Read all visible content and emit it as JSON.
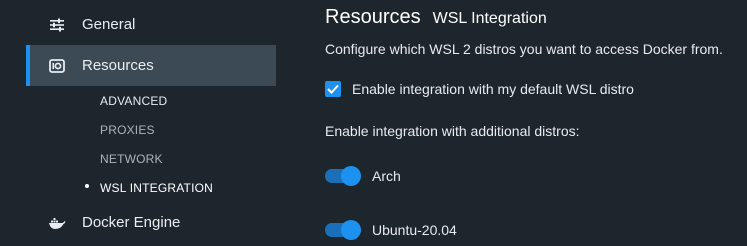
{
  "sidebar": {
    "items": [
      {
        "label": "General",
        "icon": "sliders-icon"
      },
      {
        "label": "Resources",
        "icon": "resources-icon",
        "active": true
      },
      {
        "label": "Docker Engine",
        "icon": "whale-icon"
      }
    ],
    "subitems": [
      {
        "label": "ADVANCED"
      },
      {
        "label": "PROXIES"
      },
      {
        "label": "NETWORK"
      },
      {
        "label": "WSL INTEGRATION",
        "active": true
      }
    ]
  },
  "main": {
    "title": "Resources",
    "subtitle": "WSL Integration",
    "description": "Configure which WSL 2 distros you want to access Docker from.",
    "default_distro": {
      "label": "Enable integration with my default WSL distro",
      "checked": true
    },
    "additional_label": "Enable integration with additional distros:",
    "distros": [
      {
        "name": "Arch",
        "enabled": true
      },
      {
        "name": "Ubuntu-20.04",
        "enabled": true
      }
    ]
  },
  "colors": {
    "accent": "#1d91f0",
    "background": "#1e262d",
    "active_nav": "#3b4a55"
  }
}
